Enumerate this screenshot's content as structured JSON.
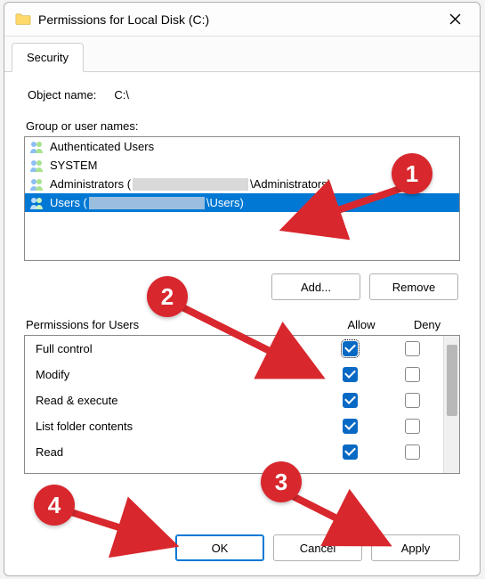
{
  "window": {
    "title": "Permissions for Local Disk (C:)"
  },
  "tab": {
    "security": "Security"
  },
  "object": {
    "label": "Object name:",
    "value": "C:\\"
  },
  "groups": {
    "label": "Group or user names:",
    "items": [
      {
        "name": "Authenticated Users",
        "selected": false,
        "redacted": false
      },
      {
        "name": "SYSTEM",
        "selected": false,
        "redacted": false
      },
      {
        "name_prefix": "Administrators (",
        "name_suffix": "\\Administrators)",
        "selected": false,
        "redacted": true
      },
      {
        "name_prefix": "Users (",
        "name_suffix": "\\Users)",
        "selected": true,
        "redacted": true
      }
    ]
  },
  "buttons": {
    "add": "Add...",
    "remove": "Remove",
    "ok": "OK",
    "cancel": "Cancel",
    "apply": "Apply"
  },
  "permissions": {
    "label": "Permissions for Users",
    "allow": "Allow",
    "deny": "Deny",
    "rows": [
      {
        "name": "Full control",
        "allow": true,
        "deny": false,
        "focus": true
      },
      {
        "name": "Modify",
        "allow": true,
        "deny": false
      },
      {
        "name": "Read & execute",
        "allow": true,
        "deny": false
      },
      {
        "name": "List folder contents",
        "allow": true,
        "deny": false
      },
      {
        "name": "Read",
        "allow": true,
        "deny": false
      }
    ]
  },
  "annotations": {
    "badges": [
      "1",
      "2",
      "3",
      "4"
    ]
  }
}
